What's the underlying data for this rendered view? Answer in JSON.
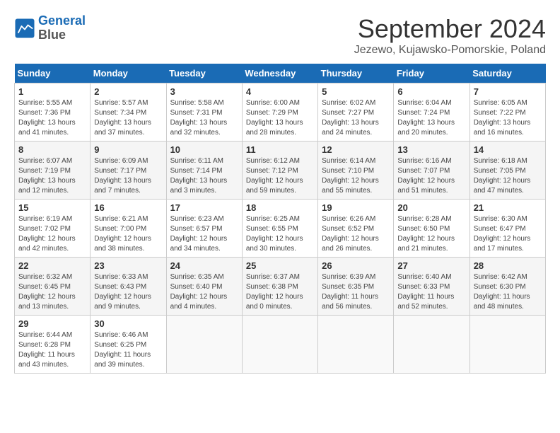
{
  "header": {
    "logo_line1": "General",
    "logo_line2": "Blue",
    "month_title": "September 2024",
    "location": "Jezewo, Kujawsko-Pomorskie, Poland"
  },
  "weekdays": [
    "Sunday",
    "Monday",
    "Tuesday",
    "Wednesday",
    "Thursday",
    "Friday",
    "Saturday"
  ],
  "weeks": [
    [
      {
        "day": "1",
        "sunrise": "5:55 AM",
        "sunset": "7:36 PM",
        "daylight": "13 hours and 41 minutes."
      },
      {
        "day": "2",
        "sunrise": "5:57 AM",
        "sunset": "7:34 PM",
        "daylight": "13 hours and 37 minutes."
      },
      {
        "day": "3",
        "sunrise": "5:58 AM",
        "sunset": "7:31 PM",
        "daylight": "13 hours and 32 minutes."
      },
      {
        "day": "4",
        "sunrise": "6:00 AM",
        "sunset": "7:29 PM",
        "daylight": "13 hours and 28 minutes."
      },
      {
        "day": "5",
        "sunrise": "6:02 AM",
        "sunset": "7:27 PM",
        "daylight": "13 hours and 24 minutes."
      },
      {
        "day": "6",
        "sunrise": "6:04 AM",
        "sunset": "7:24 PM",
        "daylight": "13 hours and 20 minutes."
      },
      {
        "day": "7",
        "sunrise": "6:05 AM",
        "sunset": "7:22 PM",
        "daylight": "13 hours and 16 minutes."
      }
    ],
    [
      {
        "day": "8",
        "sunrise": "6:07 AM",
        "sunset": "7:19 PM",
        "daylight": "13 hours and 12 minutes."
      },
      {
        "day": "9",
        "sunrise": "6:09 AM",
        "sunset": "7:17 PM",
        "daylight": "13 hours and 7 minutes."
      },
      {
        "day": "10",
        "sunrise": "6:11 AM",
        "sunset": "7:14 PM",
        "daylight": "13 hours and 3 minutes."
      },
      {
        "day": "11",
        "sunrise": "6:12 AM",
        "sunset": "7:12 PM",
        "daylight": "12 hours and 59 minutes."
      },
      {
        "day": "12",
        "sunrise": "6:14 AM",
        "sunset": "7:10 PM",
        "daylight": "12 hours and 55 minutes."
      },
      {
        "day": "13",
        "sunrise": "6:16 AM",
        "sunset": "7:07 PM",
        "daylight": "12 hours and 51 minutes."
      },
      {
        "day": "14",
        "sunrise": "6:18 AM",
        "sunset": "7:05 PM",
        "daylight": "12 hours and 47 minutes."
      }
    ],
    [
      {
        "day": "15",
        "sunrise": "6:19 AM",
        "sunset": "7:02 PM",
        "daylight": "12 hours and 42 minutes."
      },
      {
        "day": "16",
        "sunrise": "6:21 AM",
        "sunset": "7:00 PM",
        "daylight": "12 hours and 38 minutes."
      },
      {
        "day": "17",
        "sunrise": "6:23 AM",
        "sunset": "6:57 PM",
        "daylight": "12 hours and 34 minutes."
      },
      {
        "day": "18",
        "sunrise": "6:25 AM",
        "sunset": "6:55 PM",
        "daylight": "12 hours and 30 minutes."
      },
      {
        "day": "19",
        "sunrise": "6:26 AM",
        "sunset": "6:52 PM",
        "daylight": "12 hours and 26 minutes."
      },
      {
        "day": "20",
        "sunrise": "6:28 AM",
        "sunset": "6:50 PM",
        "daylight": "12 hours and 21 minutes."
      },
      {
        "day": "21",
        "sunrise": "6:30 AM",
        "sunset": "6:47 PM",
        "daylight": "12 hours and 17 minutes."
      }
    ],
    [
      {
        "day": "22",
        "sunrise": "6:32 AM",
        "sunset": "6:45 PM",
        "daylight": "12 hours and 13 minutes."
      },
      {
        "day": "23",
        "sunrise": "6:33 AM",
        "sunset": "6:43 PM",
        "daylight": "12 hours and 9 minutes."
      },
      {
        "day": "24",
        "sunrise": "6:35 AM",
        "sunset": "6:40 PM",
        "daylight": "12 hours and 4 minutes."
      },
      {
        "day": "25",
        "sunrise": "6:37 AM",
        "sunset": "6:38 PM",
        "daylight": "12 hours and 0 minutes."
      },
      {
        "day": "26",
        "sunrise": "6:39 AM",
        "sunset": "6:35 PM",
        "daylight": "11 hours and 56 minutes."
      },
      {
        "day": "27",
        "sunrise": "6:40 AM",
        "sunset": "6:33 PM",
        "daylight": "11 hours and 52 minutes."
      },
      {
        "day": "28",
        "sunrise": "6:42 AM",
        "sunset": "6:30 PM",
        "daylight": "11 hours and 48 minutes."
      }
    ],
    [
      {
        "day": "29",
        "sunrise": "6:44 AM",
        "sunset": "6:28 PM",
        "daylight": "11 hours and 43 minutes."
      },
      {
        "day": "30",
        "sunrise": "6:46 AM",
        "sunset": "6:25 PM",
        "daylight": "11 hours and 39 minutes."
      },
      null,
      null,
      null,
      null,
      null
    ]
  ]
}
